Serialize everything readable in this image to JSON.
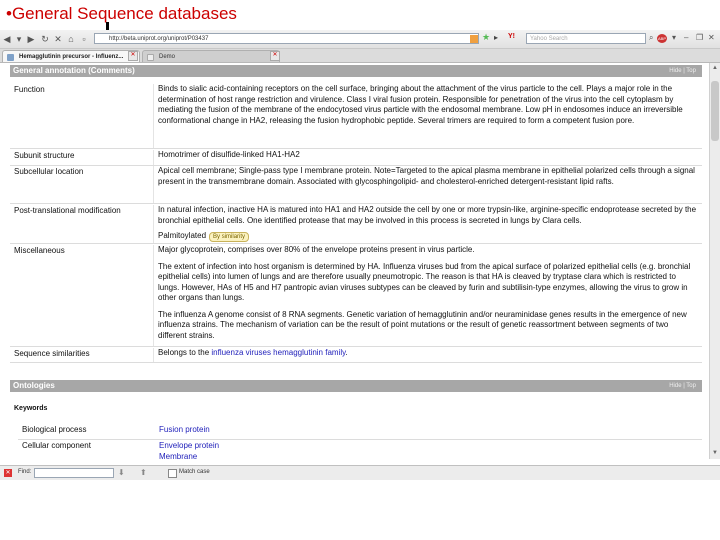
{
  "slide_title": "•General Sequence databases",
  "browser": {
    "address_url": "http://beta.uniprot.org/uniprot/P03437",
    "search_placeholder": "Yahoo Search",
    "yahoo_label": "Y!",
    "abp_label": "ABP",
    "nav_icons": [
      "back-arrow",
      "forward-arrow",
      "reload",
      "stop",
      "home"
    ],
    "tabs": [
      {
        "label": "Hemagglutinin precursor - Influenz...",
        "active": true
      },
      {
        "label": "Demo",
        "active": false
      }
    ],
    "find_label": "Find:",
    "match_case_label": "Match case"
  },
  "general_annotation": {
    "header": "General annotation (Comments)",
    "hide_top": "Hide | Top",
    "rows": [
      {
        "label": "Function",
        "text": "Binds to sialic acid-containing receptors on the cell surface, bringing about the attachment of the virus particle to the cell. Plays a major role in the determination of host range restriction and virulence. Class I viral fusion protein. Responsible for penetration of the virus into the cell cytoplasm by mediating the fusion of the membrane of the endocytosed virus particle with the endosomal membrane. Low pH in endosomes induce an irreversible conformational change in HA2, releasing the fusion hydrophobic peptide. Several trimers are required to form a competent fusion pore."
      },
      {
        "label": "Subunit structure",
        "text": "Homotrimer of disulfide-linked HA1-HA2"
      },
      {
        "label": "Subcellular location",
        "text": "Apical cell membrane; Single-pass type I membrane protein. Note=Targeted to the apical plasma membrane in epithelial polarized cells through a signal present in the transmembrane domain. Associated with glycosphingolipid- and cholesterol-enriched detergent-resistant lipid rafts."
      },
      {
        "label": "Post-translational modification",
        "text": "In natural infection, inactive HA is matured into HA1 and HA2 outside the cell by one or more trypsin-like, arginine-specific endoprotease secreted by the bronchial epithelial cells. One identified protease that may be involved in this process is secreted in lungs by Clara cells.",
        "extra": "Palmitoylated",
        "badge": "By similarity"
      },
      {
        "label": "Miscellaneous",
        "paragraphs": [
          "Major glycoprotein, comprises over 80% of the envelope proteins present in virus particle.",
          "The extent of infection into host organism is determined by HA. Influenza viruses bud from the apical surface of polarized epithelial cells (e.g. bronchial epithelial cells) into lumen of lungs and are therefore usually pneumotropic. The reason is that HA is cleaved by tryptase clara which is restricted to lungs. However, HAs of H5 and H7 pantropic avian viruses subtypes can be cleaved by furin and subtilisin-type enzymes, allowing the virus to grow in other organs than lungs.",
          "The influenza A genome consist of 8 RNA segments. Genetic variation of hemagglutinin and/or neuraminidase genes results in the emergence of new influenza strains. The mechanism of variation can be the result of point mutations or the result of genetic reassortment between segments of two different strains."
        ]
      },
      {
        "label": "Sequence similarities",
        "prefix": "Belongs to the ",
        "link": "influenza viruses hemagglutinin family",
        "suffix": "."
      }
    ]
  },
  "ontologies": {
    "header": "Ontologies",
    "hide_top": "Hide | Top",
    "keywords_label": "Keywords",
    "rows": [
      {
        "label": "Biological process",
        "values": [
          "Fusion protein"
        ]
      },
      {
        "label": "Cellular component",
        "values": [
          "Envelope protein",
          "Membrane"
        ]
      }
    ]
  }
}
